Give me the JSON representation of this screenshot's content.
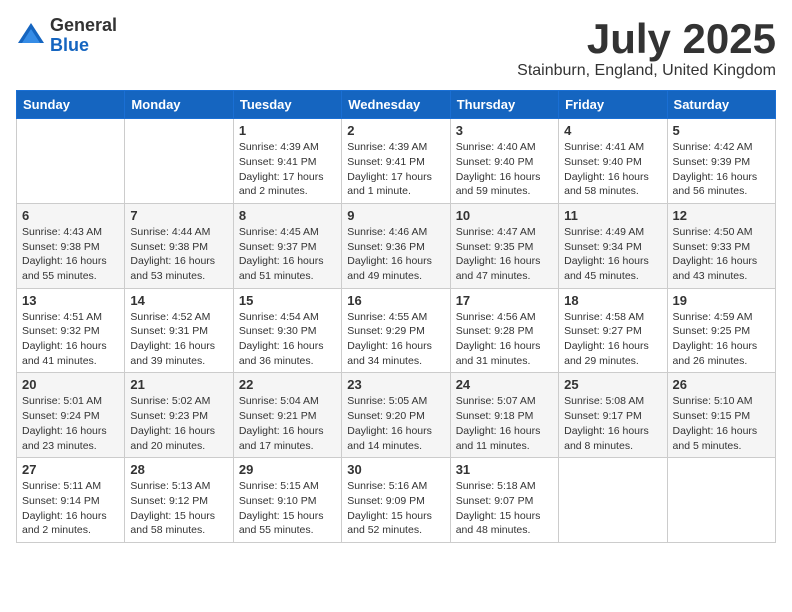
{
  "logo": {
    "general": "General",
    "blue": "Blue"
  },
  "title": "July 2025",
  "location": "Stainburn, England, United Kingdom",
  "days_of_week": [
    "Sunday",
    "Monday",
    "Tuesday",
    "Wednesday",
    "Thursday",
    "Friday",
    "Saturday"
  ],
  "weeks": [
    [
      {
        "day": "",
        "sunrise": "",
        "sunset": "",
        "daylight": ""
      },
      {
        "day": "",
        "sunrise": "",
        "sunset": "",
        "daylight": ""
      },
      {
        "day": "1",
        "sunrise": "Sunrise: 4:39 AM",
        "sunset": "Sunset: 9:41 PM",
        "daylight": "Daylight: 17 hours and 2 minutes."
      },
      {
        "day": "2",
        "sunrise": "Sunrise: 4:39 AM",
        "sunset": "Sunset: 9:41 PM",
        "daylight": "Daylight: 17 hours and 1 minute."
      },
      {
        "day": "3",
        "sunrise": "Sunrise: 4:40 AM",
        "sunset": "Sunset: 9:40 PM",
        "daylight": "Daylight: 16 hours and 59 minutes."
      },
      {
        "day": "4",
        "sunrise": "Sunrise: 4:41 AM",
        "sunset": "Sunset: 9:40 PM",
        "daylight": "Daylight: 16 hours and 58 minutes."
      },
      {
        "day": "5",
        "sunrise": "Sunrise: 4:42 AM",
        "sunset": "Sunset: 9:39 PM",
        "daylight": "Daylight: 16 hours and 56 minutes."
      }
    ],
    [
      {
        "day": "6",
        "sunrise": "Sunrise: 4:43 AM",
        "sunset": "Sunset: 9:38 PM",
        "daylight": "Daylight: 16 hours and 55 minutes."
      },
      {
        "day": "7",
        "sunrise": "Sunrise: 4:44 AM",
        "sunset": "Sunset: 9:38 PM",
        "daylight": "Daylight: 16 hours and 53 minutes."
      },
      {
        "day": "8",
        "sunrise": "Sunrise: 4:45 AM",
        "sunset": "Sunset: 9:37 PM",
        "daylight": "Daylight: 16 hours and 51 minutes."
      },
      {
        "day": "9",
        "sunrise": "Sunrise: 4:46 AM",
        "sunset": "Sunset: 9:36 PM",
        "daylight": "Daylight: 16 hours and 49 minutes."
      },
      {
        "day": "10",
        "sunrise": "Sunrise: 4:47 AM",
        "sunset": "Sunset: 9:35 PM",
        "daylight": "Daylight: 16 hours and 47 minutes."
      },
      {
        "day": "11",
        "sunrise": "Sunrise: 4:49 AM",
        "sunset": "Sunset: 9:34 PM",
        "daylight": "Daylight: 16 hours and 45 minutes."
      },
      {
        "day": "12",
        "sunrise": "Sunrise: 4:50 AM",
        "sunset": "Sunset: 9:33 PM",
        "daylight": "Daylight: 16 hours and 43 minutes."
      }
    ],
    [
      {
        "day": "13",
        "sunrise": "Sunrise: 4:51 AM",
        "sunset": "Sunset: 9:32 PM",
        "daylight": "Daylight: 16 hours and 41 minutes."
      },
      {
        "day": "14",
        "sunrise": "Sunrise: 4:52 AM",
        "sunset": "Sunset: 9:31 PM",
        "daylight": "Daylight: 16 hours and 39 minutes."
      },
      {
        "day": "15",
        "sunrise": "Sunrise: 4:54 AM",
        "sunset": "Sunset: 9:30 PM",
        "daylight": "Daylight: 16 hours and 36 minutes."
      },
      {
        "day": "16",
        "sunrise": "Sunrise: 4:55 AM",
        "sunset": "Sunset: 9:29 PM",
        "daylight": "Daylight: 16 hours and 34 minutes."
      },
      {
        "day": "17",
        "sunrise": "Sunrise: 4:56 AM",
        "sunset": "Sunset: 9:28 PM",
        "daylight": "Daylight: 16 hours and 31 minutes."
      },
      {
        "day": "18",
        "sunrise": "Sunrise: 4:58 AM",
        "sunset": "Sunset: 9:27 PM",
        "daylight": "Daylight: 16 hours and 29 minutes."
      },
      {
        "day": "19",
        "sunrise": "Sunrise: 4:59 AM",
        "sunset": "Sunset: 9:25 PM",
        "daylight": "Daylight: 16 hours and 26 minutes."
      }
    ],
    [
      {
        "day": "20",
        "sunrise": "Sunrise: 5:01 AM",
        "sunset": "Sunset: 9:24 PM",
        "daylight": "Daylight: 16 hours and 23 minutes."
      },
      {
        "day": "21",
        "sunrise": "Sunrise: 5:02 AM",
        "sunset": "Sunset: 9:23 PM",
        "daylight": "Daylight: 16 hours and 20 minutes."
      },
      {
        "day": "22",
        "sunrise": "Sunrise: 5:04 AM",
        "sunset": "Sunset: 9:21 PM",
        "daylight": "Daylight: 16 hours and 17 minutes."
      },
      {
        "day": "23",
        "sunrise": "Sunrise: 5:05 AM",
        "sunset": "Sunset: 9:20 PM",
        "daylight": "Daylight: 16 hours and 14 minutes."
      },
      {
        "day": "24",
        "sunrise": "Sunrise: 5:07 AM",
        "sunset": "Sunset: 9:18 PM",
        "daylight": "Daylight: 16 hours and 11 minutes."
      },
      {
        "day": "25",
        "sunrise": "Sunrise: 5:08 AM",
        "sunset": "Sunset: 9:17 PM",
        "daylight": "Daylight: 16 hours and 8 minutes."
      },
      {
        "day": "26",
        "sunrise": "Sunrise: 5:10 AM",
        "sunset": "Sunset: 9:15 PM",
        "daylight": "Daylight: 16 hours and 5 minutes."
      }
    ],
    [
      {
        "day": "27",
        "sunrise": "Sunrise: 5:11 AM",
        "sunset": "Sunset: 9:14 PM",
        "daylight": "Daylight: 16 hours and 2 minutes."
      },
      {
        "day": "28",
        "sunrise": "Sunrise: 5:13 AM",
        "sunset": "Sunset: 9:12 PM",
        "daylight": "Daylight: 15 hours and 58 minutes."
      },
      {
        "day": "29",
        "sunrise": "Sunrise: 5:15 AM",
        "sunset": "Sunset: 9:10 PM",
        "daylight": "Daylight: 15 hours and 55 minutes."
      },
      {
        "day": "30",
        "sunrise": "Sunrise: 5:16 AM",
        "sunset": "Sunset: 9:09 PM",
        "daylight": "Daylight: 15 hours and 52 minutes."
      },
      {
        "day": "31",
        "sunrise": "Sunrise: 5:18 AM",
        "sunset": "Sunset: 9:07 PM",
        "daylight": "Daylight: 15 hours and 48 minutes."
      },
      {
        "day": "",
        "sunrise": "",
        "sunset": "",
        "daylight": ""
      },
      {
        "day": "",
        "sunrise": "",
        "sunset": "",
        "daylight": ""
      }
    ]
  ]
}
